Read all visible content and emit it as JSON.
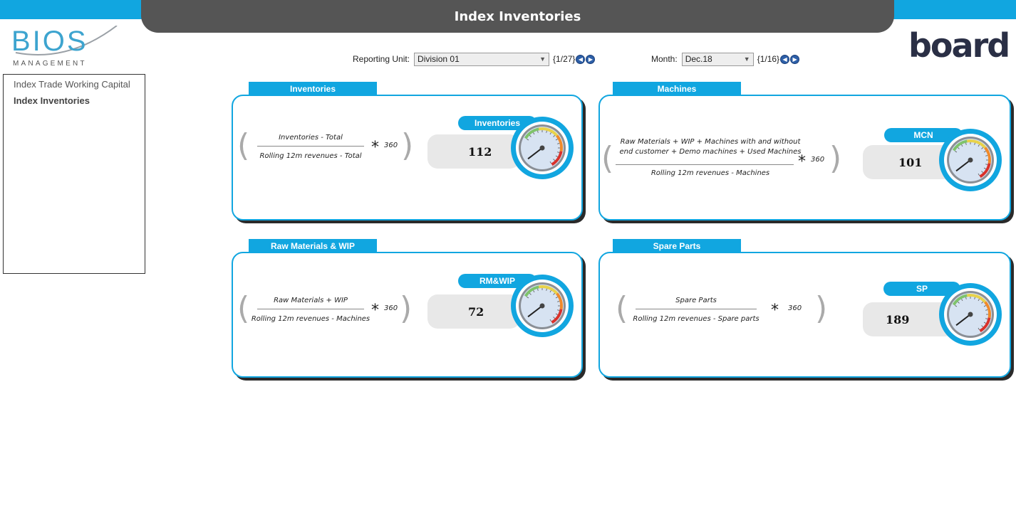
{
  "header": {
    "title": "Index Inventories"
  },
  "logos": {
    "bios_word": "BIOS",
    "bios_sub": "MANAGEMENT",
    "board_word": "board"
  },
  "sidebar": {
    "items": [
      {
        "label": "Index Trade Working Capital"
      },
      {
        "label": "Index Inventories"
      }
    ]
  },
  "filters": {
    "reporting_unit": {
      "label": "Reporting Unit:",
      "value": "Division 01",
      "count": "{1/27}"
    },
    "month": {
      "label": "Month:",
      "value": "Dec.18",
      "count": "{1/16}"
    }
  },
  "panels": [
    {
      "tab": "Inventories",
      "numerator": "Inventories - Total",
      "denominator": "Rolling 12m revenues - Total",
      "multiplier": "360",
      "pill": "Inventories",
      "value": "112"
    },
    {
      "tab": "Machines",
      "numerator": "Raw Materials + WIP + Machines with and without",
      "numerator2": "end customer + Demo machines + Used Machines",
      "denominator": "Rolling 12m revenues - Machines",
      "multiplier": "360",
      "pill": "MCN",
      "value": "101"
    },
    {
      "tab": "Raw Materials & WIP",
      "numerator": "Raw Materials + WIP",
      "denominator": "Rolling 12m revenues - Machines",
      "multiplier": "360",
      "pill": "RM&WIP",
      "value": "72"
    },
    {
      "tab": "Spare Parts",
      "numerator": "Spare Parts",
      "denominator": "Rolling 12m revenues - Spare parts",
      "multiplier": "360",
      "pill": "SP",
      "value": "189"
    }
  ],
  "icons": {
    "gauge": "speedometer-gauge-icon",
    "prev": "prev-arrow-icon",
    "next": "next-arrow-icon",
    "dropdown": "chevron-down-icon"
  },
  "colors": {
    "accent": "#11a6e0",
    "title_bar": "#555555"
  }
}
